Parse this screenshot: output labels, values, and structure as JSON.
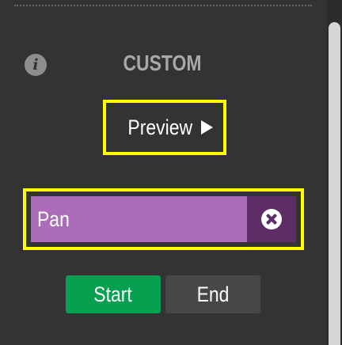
{
  "panel": {
    "title": "CUSTOM",
    "info_icon": "info-icon"
  },
  "preview": {
    "label": "Preview",
    "icon": "play-icon"
  },
  "tag": {
    "label": "Pan",
    "clear_icon": "close-circle-icon",
    "color": "#ac6cb9"
  },
  "buttons": {
    "start_label": "Start",
    "end_label": "End"
  },
  "colors": {
    "highlight": "#ffff00",
    "start": "#05a050",
    "end": "#474747",
    "background": "#333333"
  }
}
